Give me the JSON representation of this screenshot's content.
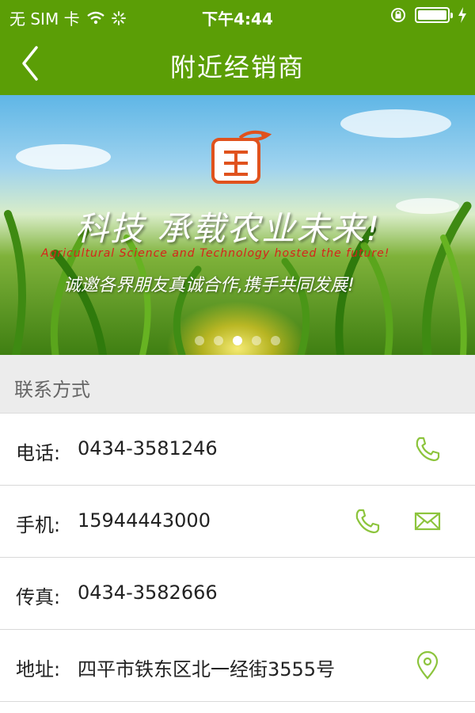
{
  "status_bar": {
    "carrier": "无 SIM 卡",
    "time": "下午4:44",
    "icons": [
      "wifi-icon",
      "activity-spinner-icon",
      "orientation-lock-icon",
      "battery-icon",
      "charging-icon"
    ]
  },
  "nav": {
    "title": "附近经销商",
    "back_icon": "chevron-left-icon"
  },
  "banner": {
    "headline": "科技 承载农业未来!",
    "english": "Agricultural Science and Technology hosted the future!",
    "subline": "诚邀各界朋友真诚合作,携手共同发展!",
    "logo_glyph": "国",
    "dots_total": 5,
    "active_dot": 3
  },
  "section": {
    "title": "联系方式"
  },
  "contacts": [
    {
      "label": "电话:",
      "value": "0434-3581246",
      "actions": [
        "phone-icon"
      ]
    },
    {
      "label": "手机:",
      "value": "15944443000",
      "actions": [
        "phone-icon",
        "mail-icon"
      ]
    },
    {
      "label": "传真:",
      "value": "0434-3582666",
      "actions": []
    },
    {
      "label": "地址:",
      "value": "四平市铁东区北一经街3555号",
      "actions": [
        "location-pin-icon"
      ]
    }
  ],
  "colors": {
    "brand_green": "#5b9e06",
    "icon_green": "#8cc43c",
    "section_bg": "#ececec"
  }
}
